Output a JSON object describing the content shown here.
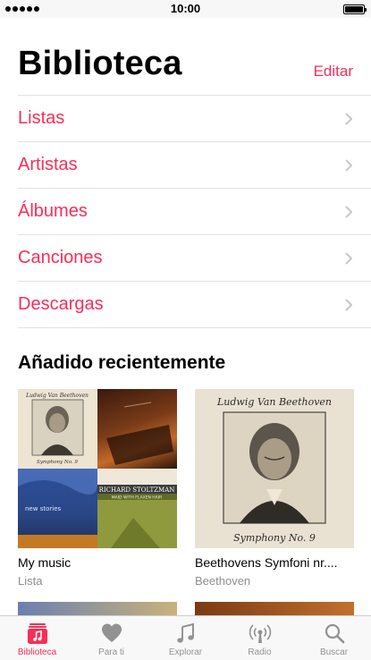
{
  "status_bar": {
    "time": "10:00"
  },
  "header": {
    "title": "Biblioteca",
    "edit_label": "Editar"
  },
  "library_items": [
    {
      "label": "Listas"
    },
    {
      "label": "Artistas"
    },
    {
      "label": "Álbumes"
    },
    {
      "label": "Canciones"
    },
    {
      "label": "Descargas"
    }
  ],
  "recently_added": {
    "title": "Añadido recientemente",
    "albums": [
      {
        "title": "My music",
        "subtitle": "Lista",
        "art": {
          "mosaic_text": [
            "Ludwig Van Beethoven",
            "Symphony No. 9",
            "new stories",
            "RICHARD STOLTZMAN",
            "MAID WITH FLAXEN HAIR"
          ]
        }
      },
      {
        "title": "Beethovens Symfoni nr....",
        "subtitle": "Beethoven",
        "art": {
          "header": "Ludwig Van Beethoven",
          "footer": "Symphony No. 9"
        }
      }
    ]
  },
  "tab_bar": {
    "active": "Biblioteca",
    "tabs": [
      {
        "label": "Biblioteca",
        "icon": "library-icon"
      },
      {
        "label": "Para ti",
        "icon": "heart-icon"
      },
      {
        "label": "Explorar",
        "icon": "music-note-icon"
      },
      {
        "label": "Radio",
        "icon": "radio-icon"
      },
      {
        "label": "Buscar",
        "icon": "search-icon"
      }
    ]
  },
  "colors": {
    "accent": "#fa2d55",
    "secondary_text": "#8e8e93",
    "divider": "#e2e2e2"
  }
}
